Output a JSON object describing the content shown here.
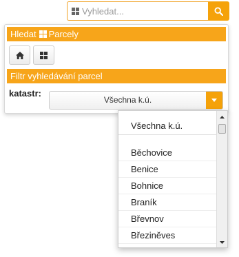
{
  "search": {
    "placeholder": "Vyhledat..."
  },
  "panel": {
    "header_prefix": "Hledat",
    "header_suffix": "Parcely",
    "filter_title": "Filtr vyhledávání parcel",
    "filter_label": "katastr:",
    "selected_value": "Všechna k.ú."
  },
  "dropdown": {
    "items": [
      "Všechna k.ú.",
      "Běchovice",
      "Benice",
      "Bohnice",
      "Braník",
      "Břevnov",
      "Březiněves"
    ]
  },
  "colors": {
    "accent": "#f5a20a",
    "header_bar": "#f7a51a"
  },
  "icons": [
    "grid-icon",
    "search-icon",
    "home-icon",
    "caret-down-icon",
    "scroll-up-icon",
    "scroll-down-icon"
  ]
}
